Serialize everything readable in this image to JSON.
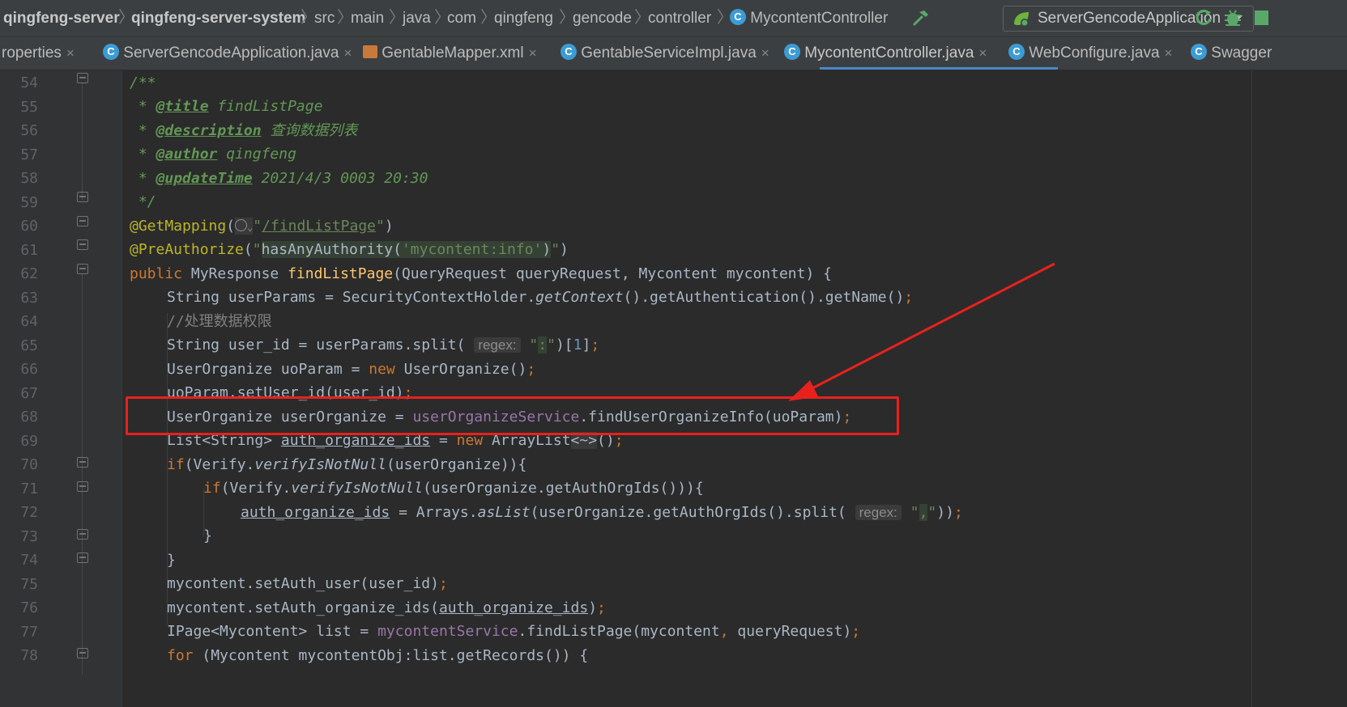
{
  "breadcrumb": {
    "items": [
      "qingfeng-server",
      "qingfeng-server-system",
      "src",
      "main",
      "java",
      "com",
      "qingfeng",
      "gencode",
      "controller",
      "MycontentController"
    ],
    "class_icon_letter": "C"
  },
  "run_config": {
    "label": "ServerGencodeApplication"
  },
  "tabs": [
    {
      "label": "roperties"
    },
    {
      "label": "ServerGencodeApplication.java"
    },
    {
      "label": "GentableMapper.xml"
    },
    {
      "label": "GentableServiceImpl.java"
    },
    {
      "label": "MycontentController.java",
      "active": true
    },
    {
      "label": "WebConfigure.java"
    },
    {
      "label": "Swagger"
    }
  ],
  "tab_close_glyph": "×",
  "editor": {
    "line_numbers": [
      "54",
      "55",
      "56",
      "57",
      "58",
      "59",
      "60",
      "61",
      "62",
      "63",
      "64",
      "65",
      "66",
      "67",
      "68",
      "69",
      "70",
      "71",
      "72",
      "73",
      "74",
      "75",
      "76",
      "77",
      "78"
    ],
    "hint_regex": "regex:",
    "tokens": {
      "doc_open": "/**",
      "star": " * ",
      "tag_title": "@title",
      "val_title": " findListPage",
      "tag_desc": "@description",
      "val_desc": " 查询数据列表",
      "tag_author": "@author",
      "val_author": " qingfeng",
      "tag_update": "@updateTime",
      "val_update": " 2021/4/3 0003 20:30",
      "doc_close": " */",
      "ann_get": "@GetMapping",
      "url": "/findListPage",
      "ann_pre": "@PreAuthorize",
      "has_any": "hasAnyAuthority(",
      "perm": "'mycontent:info'",
      "kw_public": "public",
      "ret_type": " MyResponse ",
      "method_name": "findListPage",
      "params": "(QueryRequest queryRequest, Mycontent mycontent) {",
      "l63": "String userParams = SecurityContextHolder.",
      "l63_get_ctx": "getContext",
      "l63_tail": "().getAuthentication().getName()",
      "l64": "//处理数据权限",
      "l65a": "String user_id = userParams.split(",
      "l65_colon": ":",
      "l65b": ")[",
      "l65_idx": "1",
      "l65c": "]",
      "l66a": "UserOrganize uoParam = ",
      "kw_new": "new",
      "l66b": " UserOrganize()",
      "l67": "uoParam.setUser_id(user_id)",
      "l68a": "UserOrganize userOrganize = ",
      "l68_svc": "userOrganizeService",
      "l68b": ".findUserOrganizeInfo(uoParam)",
      "l69a": "List<String> ",
      "l69_var": "auth_organize_ids",
      "l69b": " = ",
      "l69c": " ArrayList",
      "l69_diamond": "<~>",
      "l69d": "()",
      "kw_if": "if",
      "l70a": "(Verify.",
      "verify_fn": "verifyIsNotNull",
      "l70b": "(userOrganize)){",
      "l71b": "(userOrganize.getAuthOrgIds())){",
      "l72a": " = Arrays.",
      "as_list": "asList",
      "l72b": "(userOrganize.getAuthOrgIds().split(",
      "l72_comma": ",",
      "l72c": "))",
      "close_brace": "}",
      "l75": "mycontent.setAuth_user(user_id)",
      "l76a": "mycontent.setAuth_organize_ids(",
      "l76b": ")",
      "l77a": "IPage<Mycontent> list = ",
      "l77_svc": "mycontentService",
      "l77b": ".findListPage(mycontent",
      "l77c": " queryRequest)",
      "kw_for": "for",
      "l78": " (Mycontent mycontentObj:list.getRecords()) {",
      "semi": ";",
      "comma": ",",
      "quote": "\""
    }
  },
  "colors": {
    "highlight_box": "#e8211d",
    "arrow": "#e8211d",
    "keyword": "#cc7832",
    "string": "#6a8759",
    "method_decl": "#ffc66d",
    "field": "#9876aa"
  }
}
